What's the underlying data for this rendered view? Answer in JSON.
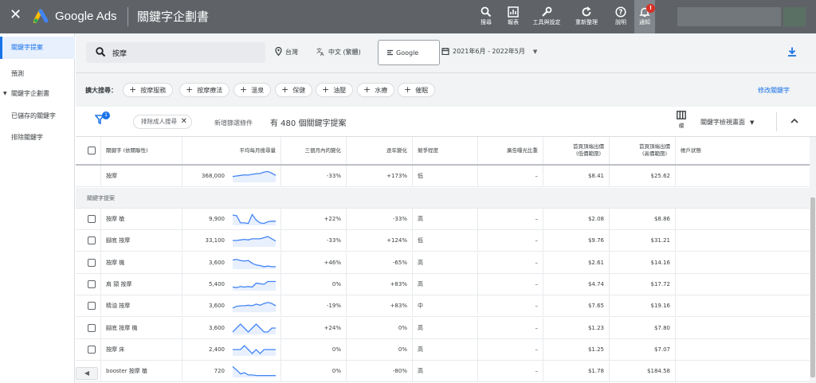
{
  "app": {
    "brand": "Google Ads",
    "title": "關鍵字企劃書"
  },
  "toolbar": [
    {
      "name": "search",
      "label": "搜尋"
    },
    {
      "name": "reports",
      "label": "報表"
    },
    {
      "name": "tools",
      "label": "工具與設定"
    },
    {
      "name": "refresh",
      "label": "重新整理"
    },
    {
      "name": "help",
      "label": "說明"
    },
    {
      "name": "notifications",
      "label": "通知",
      "badge": "!"
    }
  ],
  "sidebar": {
    "items": [
      {
        "label": "關鍵字提案",
        "active": true
      },
      {
        "label": "預測"
      },
      {
        "label": "關鍵字企劃書",
        "expand": "▼"
      },
      {
        "label": "已儲存的關鍵字"
      },
      {
        "label": "排除關鍵字"
      }
    ]
  },
  "search": {
    "keyword": "按摩",
    "location": "台灣",
    "language": "中文 (繁體)",
    "engine": "Google",
    "date_range": "2021年6月 - 2022年5月"
  },
  "expand": {
    "lead": "擴大搜尋：",
    "chips": [
      "按摩服務",
      "按摩療法",
      "溫泉",
      "保健",
      "油壓",
      "水療",
      "催眠"
    ],
    "edit_label": "修改關鍵字"
  },
  "filters": {
    "filter_count": "1",
    "exclude_chip": "排除成人搜尋",
    "add_filter": "新增篩選條件",
    "count_text": "有 480 個關鍵字提案",
    "columns_label": "欄",
    "view_label": "關鍵字檢視畫面"
  },
  "table": {
    "headers": {
      "keyword": "關鍵字 (依關聯性)",
      "avg": "平均每月搜尋量",
      "three_month": "三個月內的變化",
      "yoy": "逐年變化",
      "competition": "競爭程度",
      "impression_share": "廣告曝光比重",
      "bid_low": "首頁頂端出價\n(低價範圍)",
      "bid_high": "首頁頂端出價\n(高價範圍)",
      "account_status": "帳戶狀態"
    },
    "seed_row": {
      "keyword": "按摩",
      "avg": "368,000",
      "three_month": "-33%",
      "yoy": "+173%",
      "competition": "低",
      "impression_share": "–",
      "bid_low": "$8.41",
      "bid_high": "$25.62",
      "trend": [
        0.55,
        0.5,
        0.45,
        0.4,
        0.42,
        0.35,
        0.3,
        0.28,
        0.15,
        0.1,
        0.25,
        0.45
      ]
    },
    "group_label": "關鍵字提案",
    "rows": [
      {
        "keyword": "按摩 槍",
        "avg": "9,900",
        "three_month": "+22%",
        "yoy": "-33%",
        "competition": "高",
        "impression_share": "–",
        "bid_low": "$2.08",
        "bid_high": "$8.86",
        "trend": [
          0.15,
          0.2,
          0.85,
          0.85,
          0.9,
          0.1,
          0.6,
          0.85,
          0.9,
          0.75,
          0.7,
          0.7
        ]
      },
      {
        "keyword": "腳底 按摩",
        "avg": "33,100",
        "three_month": "-33%",
        "yoy": "+124%",
        "competition": "低",
        "impression_share": "–",
        "bid_low": "$9.76",
        "bid_high": "$31.21",
        "trend": [
          0.5,
          0.5,
          0.45,
          0.4,
          0.45,
          0.35,
          0.35,
          0.35,
          0.25,
          0.15,
          0.35,
          0.55
        ]
      },
      {
        "keyword": "按摩 機",
        "avg": "3,600",
        "three_month": "+46%",
        "yoy": "-65%",
        "competition": "高",
        "impression_share": "–",
        "bid_low": "$2.61",
        "bid_high": "$14.16",
        "trend": [
          0.25,
          0.2,
          0.3,
          0.35,
          0.3,
          0.55,
          0.7,
          0.75,
          0.85,
          0.8,
          0.85,
          0.85
        ]
      },
      {
        "keyword": "肩 頸 按摩",
        "avg": "5,400",
        "three_month": "0%",
        "yoy": "+83%",
        "competition": "高",
        "impression_share": "–",
        "bid_low": "$4.74",
        "bid_high": "$17.72",
        "trend": [
          0.75,
          0.8,
          0.7,
          0.75,
          0.7,
          0.75,
          0.4,
          0.45,
          0.5,
          0.25,
          0.25,
          0.25
        ]
      },
      {
        "keyword": "精油 按摩",
        "avg": "3,600",
        "three_month": "-19%",
        "yoy": "+83%",
        "competition": "中",
        "impression_share": "–",
        "bid_low": "$7.65",
        "bid_high": "$19.16",
        "trend": [
          0.7,
          0.55,
          0.5,
          0.5,
          0.45,
          0.5,
          0.35,
          0.45,
          0.3,
          0.2,
          0.3,
          0.5
        ]
      },
      {
        "keyword": "腳底 按摩 機",
        "avg": "3,600",
        "three_month": "+24%",
        "yoy": "0%",
        "competition": "高",
        "impression_share": "–",
        "bid_low": "$1.23",
        "bid_high": "$7.80",
        "trend": [
          0.85,
          0.5,
          0.15,
          0.5,
          0.85,
          0.5,
          0.15,
          0.5,
          0.85,
          0.85,
          0.5,
          0.5
        ]
      },
      {
        "keyword": "按摩 床",
        "avg": "2,400",
        "three_month": "0%",
        "yoy": "0%",
        "competition": "高",
        "impression_share": "–",
        "bid_low": "$1.25",
        "bid_high": "$7.07",
        "trend": [
          0.5,
          0.5,
          0.5,
          0.15,
          0.5,
          0.85,
          0.5,
          0.85,
          0.5,
          0.5,
          0.5,
          0.5
        ]
      },
      {
        "keyword": "booster 按摩 槍",
        "avg": "720",
        "three_month": "0%",
        "yoy": "-80%",
        "competition": "高",
        "impression_share": "–",
        "bid_low": "$1.78",
        "bid_high": "$184.58",
        "trend": [
          0.1,
          0.4,
          0.75,
          0.65,
          0.85,
          0.85,
          0.9,
          0.9,
          0.9,
          0.9,
          0.9,
          0.9
        ]
      }
    ]
  },
  "colors": {
    "topbar": "#5f6368",
    "accent": "#1a73e8",
    "sparkline": "#4285f4",
    "sparkline_fill": "#e8f0fe"
  }
}
